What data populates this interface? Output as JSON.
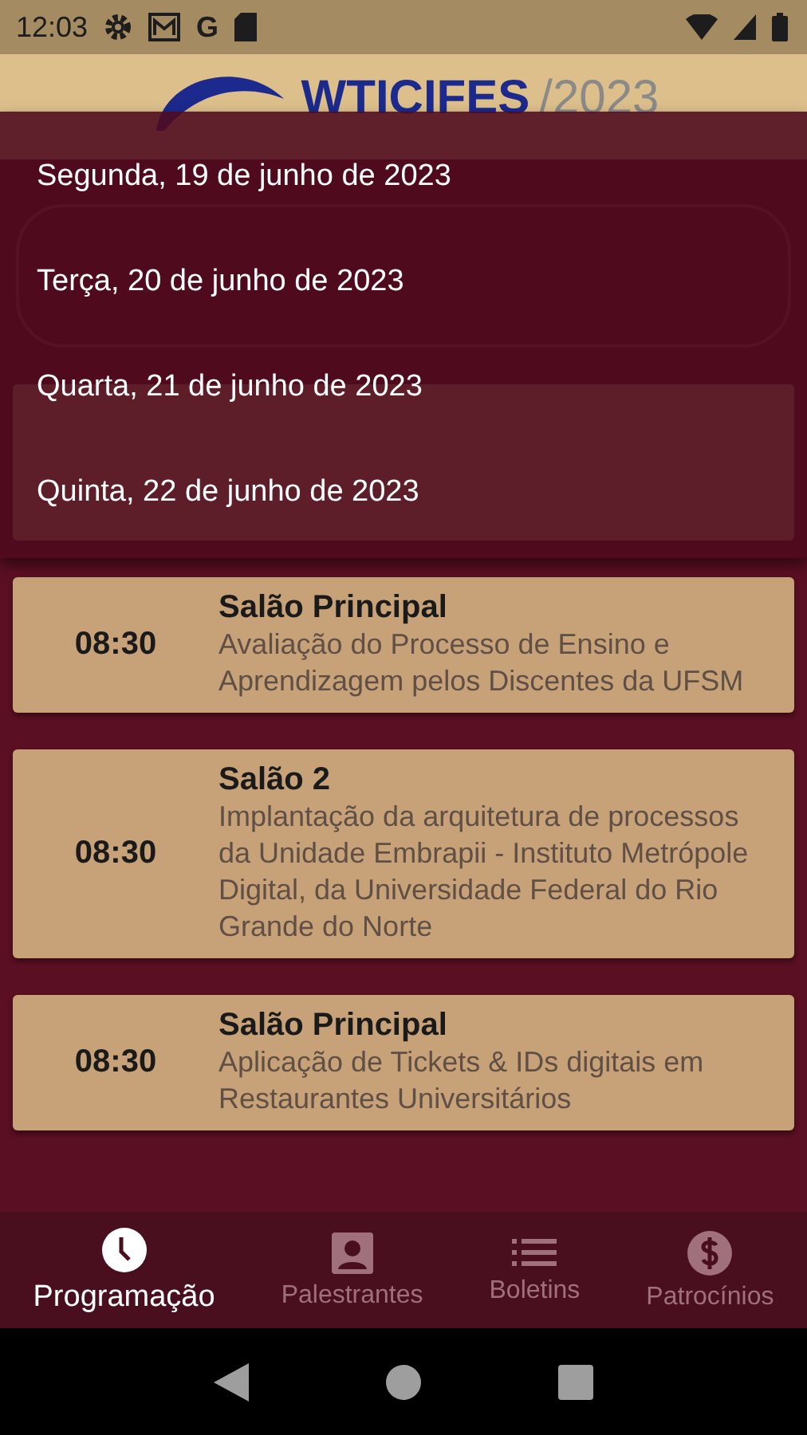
{
  "status_bar": {
    "time": "12:03",
    "g_label": "G"
  },
  "header": {
    "logo_name": "WTICIFES",
    "logo_year": "/2023"
  },
  "day_menu": {
    "items": [
      {
        "label": "Segunda, 19 de junho de 2023",
        "selected": false
      },
      {
        "label": "Terça, 20 de junho de 2023",
        "selected": false
      },
      {
        "label": "Quarta, 21 de junho de 2023",
        "selected": false
      },
      {
        "label": "Quinta, 22 de junho de 2023",
        "selected": false
      }
    ]
  },
  "sessions": [
    {
      "time": "08:30",
      "room": "Salão Principal",
      "title": "Avaliação do Processo de Ensino e Aprendizagem pelos Discentes da UFSM"
    },
    {
      "time": "08:30",
      "room": "Salão 2",
      "title": "Implantação da arquitetura de processos da Unidade Embrapii - Instituto Metrópole Digital, da Universidade Federal do Rio Grande do Norte"
    },
    {
      "time": "08:30",
      "room": "Salão Principal",
      "title": "Aplicação de Tickets & IDs digitais em Restaurantes Universitários"
    }
  ],
  "bottom_nav": [
    {
      "label": "Programação",
      "kind": "clock",
      "selected": true
    },
    {
      "label": "Palestrantes",
      "kind": "person",
      "selected": false
    },
    {
      "label": "Boletins",
      "kind": "list",
      "selected": false
    },
    {
      "label": "Patrocínios",
      "kind": "dollar",
      "selected": false
    }
  ]
}
